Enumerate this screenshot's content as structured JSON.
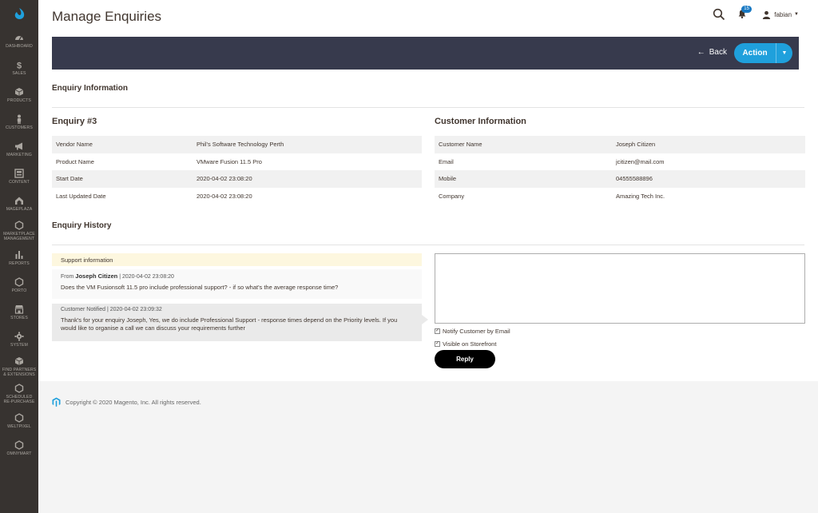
{
  "sidebar": {
    "items": [
      {
        "label": "DASHBOARD",
        "icon": "dashboard-icon"
      },
      {
        "label": "SALES",
        "icon": "dollar-icon"
      },
      {
        "label": "PRODUCTS",
        "icon": "cube-icon"
      },
      {
        "label": "CUSTOMERS",
        "icon": "person-icon"
      },
      {
        "label": "MARKETING",
        "icon": "megaphone-icon"
      },
      {
        "label": "CONTENT",
        "icon": "content-icon"
      },
      {
        "label": "MAGEPLAZA",
        "icon": "mageplaza-icon"
      },
      {
        "label": "MARKETPLACE\nMANAGEMENT",
        "icon": "hexagon-icon"
      },
      {
        "label": "REPORTS",
        "icon": "bar-chart-icon"
      },
      {
        "label": "PORTO",
        "icon": "hexagon-icon"
      },
      {
        "label": "STORES",
        "icon": "store-icon"
      },
      {
        "label": "SYSTEM",
        "icon": "gear-icon"
      },
      {
        "label": "FIND PARTNERS\n& EXTENSIONS",
        "icon": "extensions-icon"
      },
      {
        "label": "SCHEDULED\nRE-PURCHASE",
        "icon": "hexagon-icon"
      },
      {
        "label": "WELTPIXEL",
        "icon": "hexagon-icon"
      },
      {
        "label": "OMNYMART",
        "icon": "hexagon-icon"
      }
    ]
  },
  "header": {
    "title": "Manage Enquiries",
    "notifications_count": "15",
    "user_name": "fabian"
  },
  "action_bar": {
    "back_label": "Back",
    "action_label": "Action"
  },
  "enquiry_information": {
    "section_title": "Enquiry Information",
    "enquiry_title": "Enquiry #3",
    "rows": [
      {
        "label": "Vendor Name",
        "value": "Phil's Software Technology Perth"
      },
      {
        "label": "Product Name",
        "value": "VMware Fusion 11.5 Pro"
      },
      {
        "label": "Start Date",
        "value": "2020-04-02 23:08:20"
      },
      {
        "label": "Last Updated Date",
        "value": "2020-04-02 23:08:20"
      }
    ]
  },
  "customer_information": {
    "title": "Customer Information",
    "rows": [
      {
        "label": "Customer Name",
        "value": "Joseph Citizen"
      },
      {
        "label": "Email",
        "value": "jcitizen@mail.com"
      },
      {
        "label": "Mobile",
        "value": "04555588896"
      },
      {
        "label": "Company",
        "value": "Amazing Tech Inc."
      }
    ]
  },
  "enquiry_history": {
    "section_title": "Enquiry History",
    "support_info": "Support information",
    "messages": [
      {
        "from_prefix": "From",
        "author": "Joseph Citizen",
        "date": "| 2020-04-02 23:08:20",
        "body": "Does the VM Fusionsoft 11.5 pro include professional support? - if so what's the average response time?"
      },
      {
        "meta": "Customer Notified | 2020-04-02 23:09:32",
        "body": "Thank's for your enquiry Joseph, Yes, we do include Professional Support - response times depend on the Priority levels. If you would like to organise a call we can discuss your requirements further"
      }
    ],
    "notify_label": "Notify Customer by Email",
    "visible_label": "Visible on Storefront",
    "reply_label": "Reply"
  },
  "footer": {
    "copyright": "Copyright © 2020 Magento, Inc. All rights reserved."
  },
  "colors": {
    "sidebar_bg": "#373330",
    "action_bar_bg": "#373a4d",
    "accent": "#1fa0dc",
    "logo": "#1fa0dc"
  }
}
